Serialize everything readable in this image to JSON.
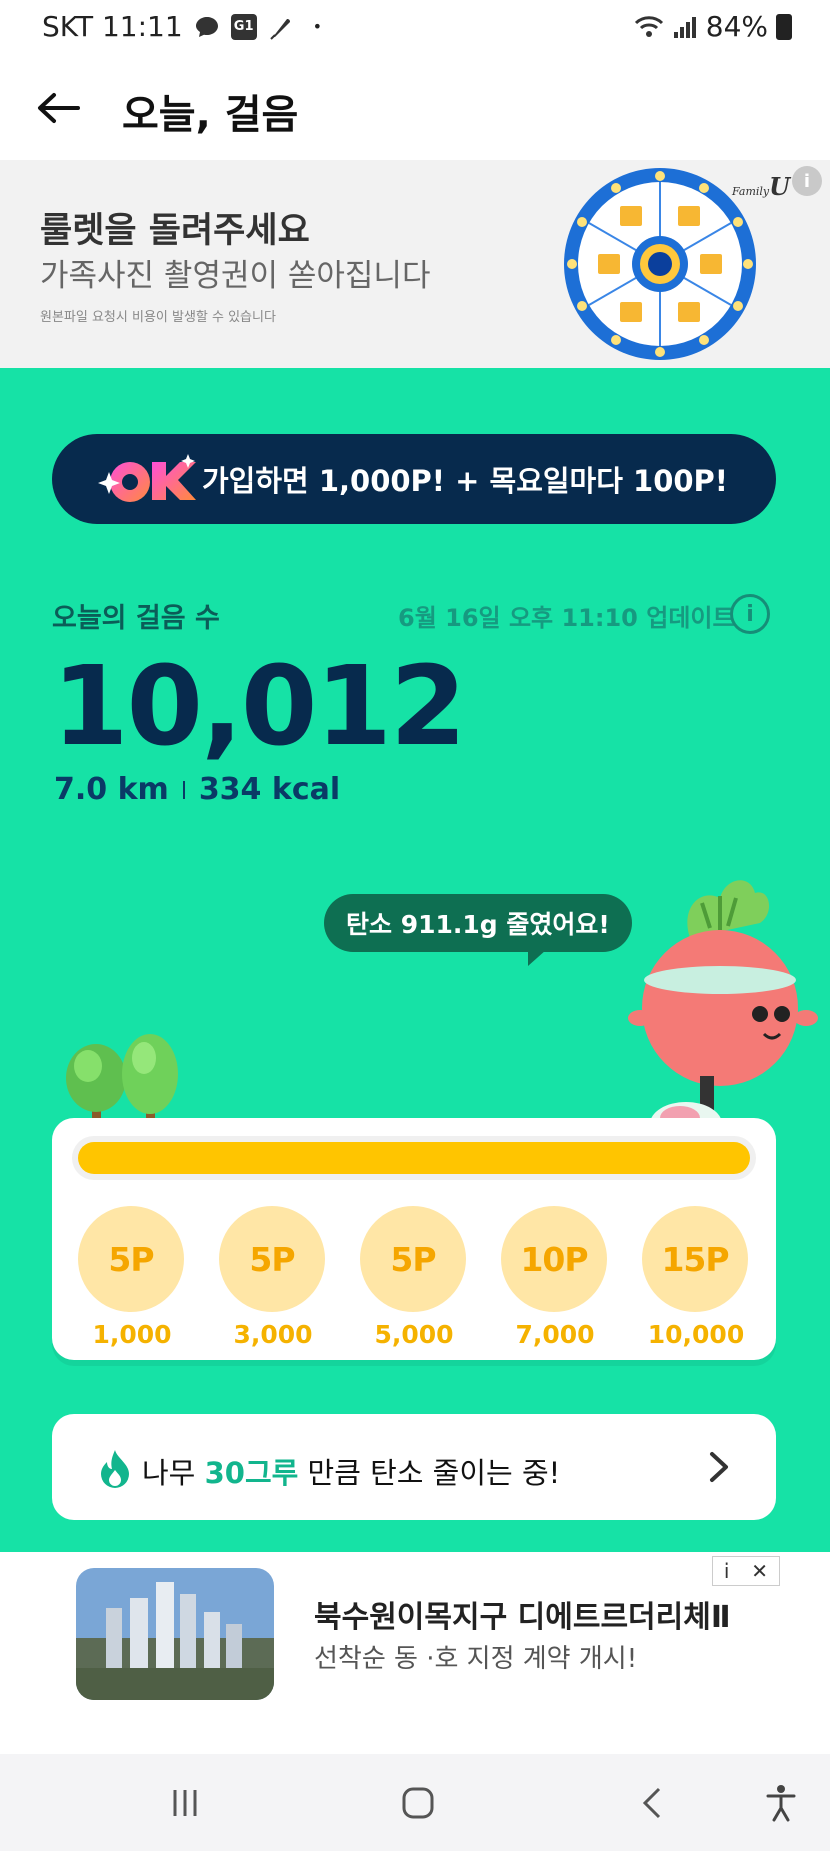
{
  "status_bar": {
    "carrier_time": "SKT 11:11",
    "badge_icon_text": "G1",
    "dot": "•",
    "battery": "84%"
  },
  "header": {
    "title": "오늘, 걸음"
  },
  "promo": {
    "title": "룰렛을 돌려주세요",
    "subtitle": "가족사진 촬영권이 쏟아집니다",
    "note": "원본파일 요청시 비용이 발생할 수 있습니다",
    "brand": "Family",
    "brand_mark": "U",
    "info": "i"
  },
  "ok_banner": {
    "text": "가입하면 1,000P! + 목요일마다 100P!"
  },
  "steps": {
    "label": "오늘의 걸음 수",
    "updated": "6월 16일 오후 11:10 업데이트",
    "info": "i",
    "count": "10,012",
    "distance": "7.0 km",
    "calories": "334 kcal"
  },
  "carbon": {
    "bubble": "탄소 911.1g 줄였어요!"
  },
  "progress": {
    "fraction": 1.0,
    "milestones": [
      {
        "points": "5P",
        "steps": "1,000"
      },
      {
        "points": "5P",
        "steps": "3,000"
      },
      {
        "points": "5P",
        "steps": "5,000"
      },
      {
        "points": "10P",
        "steps": "7,000"
      },
      {
        "points": "15P",
        "steps": "10,000"
      }
    ]
  },
  "tree_card": {
    "prefix": "나무 ",
    "highlight": "30그루",
    "suffix": " 만큼 탄소 줄이는 중!"
  },
  "ad": {
    "title": "북수원이목지구 디에트르더리체Ⅱ",
    "subtitle": "선착순 동 ·호 지정 계약 개시!",
    "info": "i",
    "close": "✕"
  },
  "colors": {
    "main_green": "#16e2a6",
    "navy": "#072a4d",
    "progress_yellow": "#ffc500",
    "highlight_green": "#12b58d"
  }
}
